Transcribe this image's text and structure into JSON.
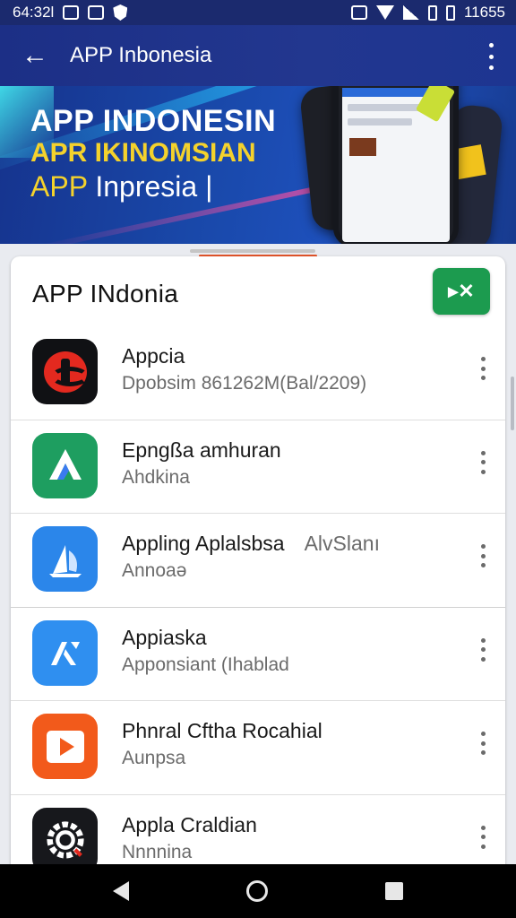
{
  "status_bar": {
    "time": "64:32l",
    "clock_right": "11655"
  },
  "app_bar": {
    "title": "APP Inbonesia"
  },
  "banner": {
    "line1": "APP INDONESIN",
    "line2": "APR IKINOMSIAN",
    "line3_prefix": "APP ",
    "line3_suffix": "Inpresia |"
  },
  "card": {
    "title": "APP   INdonia",
    "action_label": "▸✕"
  },
  "apps": [
    {
      "title": "Appcia",
      "subtitle": "Dpobsim 861262M(Bal/2209)",
      "icon": "red-circle-icon"
    },
    {
      "title": "Epngßa amhuran",
      "subtitle": "Ahdkina",
      "icon": "green-triangle-icon"
    },
    {
      "title": "Appling Aplalsbsa",
      "title_extra": "AlvSlanı",
      "subtitle": "Annoaə",
      "icon": "blue-sail-icon"
    },
    {
      "title": "Appiaska",
      "subtitle": "Apponsiant (Ihablad",
      "icon": "blue-a-icon"
    },
    {
      "title": "Phnral Cftha Rocahial",
      "subtitle": "Aunpsa",
      "icon": "orange-play-icon"
    },
    {
      "title": "Appla Craldian",
      "subtitle": "Nnnnina",
      "icon": "dark-gear-icon"
    }
  ],
  "colors": {
    "app_bar": "#1c2f86",
    "accent_green": "#1c9b4f",
    "nav_bar": "#000000"
  }
}
